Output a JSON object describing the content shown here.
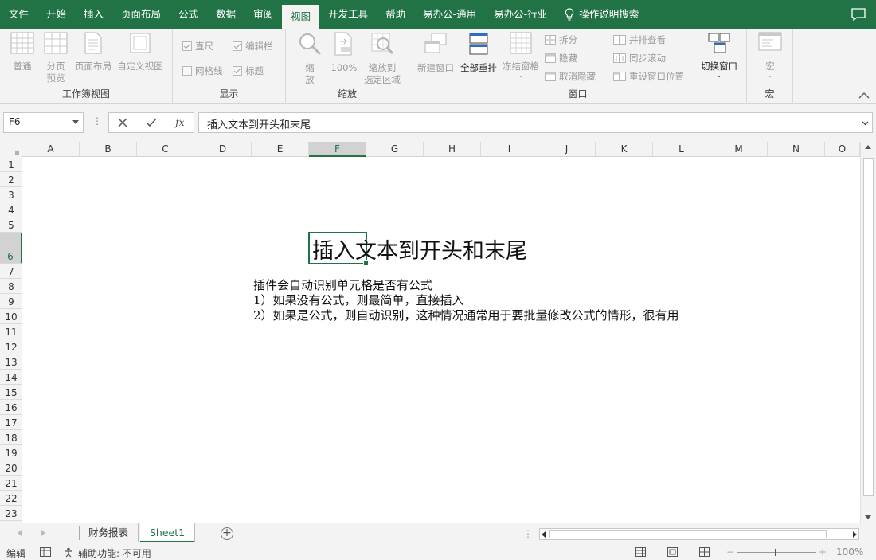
{
  "tabs": [
    "文件",
    "开始",
    "插入",
    "页面布局",
    "公式",
    "数据",
    "审阅",
    "视图",
    "开发工具",
    "帮助",
    "易办公-通用",
    "易办公-行业"
  ],
  "active_tab": "视图",
  "search_label": "操作说明搜索",
  "ribbon": {
    "workbook_views": {
      "label": "工作簿视图",
      "normal": "普通",
      "page_break_1": "分页",
      "page_break_2": "预览",
      "page_layout": "页面布局",
      "custom_views": "自定义视图"
    },
    "show": {
      "label": "显示",
      "ruler": "直尺",
      "formula_bar": "编辑栏",
      "gridlines": "网格线",
      "headings": "标题"
    },
    "zoom": {
      "label": "缩放",
      "zoom_1": "缩",
      "zoom_2": "放",
      "hundred": "100%",
      "to_sel_1": "缩放到",
      "to_sel_2": "选定区域"
    },
    "window": {
      "label": "窗口",
      "new_window": "新建窗口",
      "arrange_all": "全部重排",
      "freeze_panes": "冻结窗格",
      "split": "拆分",
      "hide": "隐藏",
      "unhide": "取消隐藏",
      "side_by_side": "并排查看",
      "sync_scroll": "同步滚动",
      "reset_position": "重设窗口位置",
      "switch_windows": "切换窗口"
    },
    "macros": {
      "label": "宏",
      "macros": "宏"
    }
  },
  "formula_bar": {
    "name_box": "F6",
    "fx": "fx",
    "content": "插入文本到开头和末尾"
  },
  "columns": [
    "A",
    "B",
    "C",
    "D",
    "E",
    "F",
    "G",
    "H",
    "I",
    "J",
    "K",
    "L",
    "M",
    "N",
    "O"
  ],
  "selected_col": "F",
  "rows": [
    "1",
    "2",
    "3",
    "4",
    "5",
    "6",
    "7",
    "8",
    "9",
    "10",
    "11",
    "12",
    "13",
    "14",
    "15",
    "16",
    "17",
    "18",
    "19",
    "20",
    "21",
    "22",
    "23"
  ],
  "selected_row": "6",
  "cells": {
    "title": "插入文本到开头和末尾",
    "line1": "插件会自动识别单元格是否有公式",
    "line2": "1）如果没有公式，则最简单，直接插入",
    "line3": "2）如果是公式，则自动识别，这种情况通常用于要批量修改公式的情形，很有用"
  },
  "sheets": [
    "财务报表",
    "Sheet1"
  ],
  "active_sheet": "Sheet1",
  "status": {
    "mode": "编辑",
    "accessibility": "辅助功能: 不可用",
    "zoom": "100%"
  },
  "colors": {
    "brand": "#217346"
  }
}
